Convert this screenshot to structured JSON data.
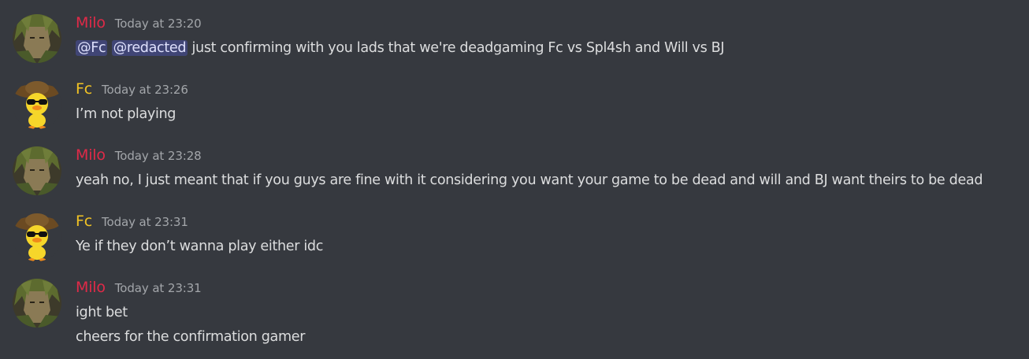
{
  "colors": {
    "background": "#36393f",
    "milo_name": "#e02a48",
    "fc_name": "#f2c324",
    "text": "#dcddde",
    "timestamp": "#a3a6aa",
    "mention_bg": "#4b5083"
  },
  "messages": [
    {
      "author": "Milo",
      "avatar_icon": "green-haired-character-avatar-icon",
      "timestamp": "Today at 23:20",
      "mentions": [
        "@Fc",
        "@redacted"
      ],
      "text": " just confirming with you lads that we're deadgaming Fc vs Spl4sh and Will vs BJ"
    },
    {
      "author": "Fc",
      "avatar_icon": "duck-with-hat-and-sunglasses-avatar-icon",
      "timestamp": "Today at 23:26",
      "text": "I’m not playing"
    },
    {
      "author": "Milo",
      "avatar_icon": "green-haired-character-avatar-icon",
      "timestamp": "Today at 23:28",
      "text": "yeah no, I just meant that if you guys are fine with it considering you want your game to be dead and will and BJ want theirs to be dead"
    },
    {
      "author": "Fc",
      "avatar_icon": "duck-with-hat-and-sunglasses-avatar-icon",
      "timestamp": "Today at 23:31",
      "text": "Ye if they don’t wanna play either idc"
    },
    {
      "author": "Milo",
      "avatar_icon": "green-haired-character-avatar-icon",
      "timestamp": "Today at 23:31",
      "lines": [
        "ight bet",
        "cheers for the confirmation gamer"
      ]
    }
  ]
}
